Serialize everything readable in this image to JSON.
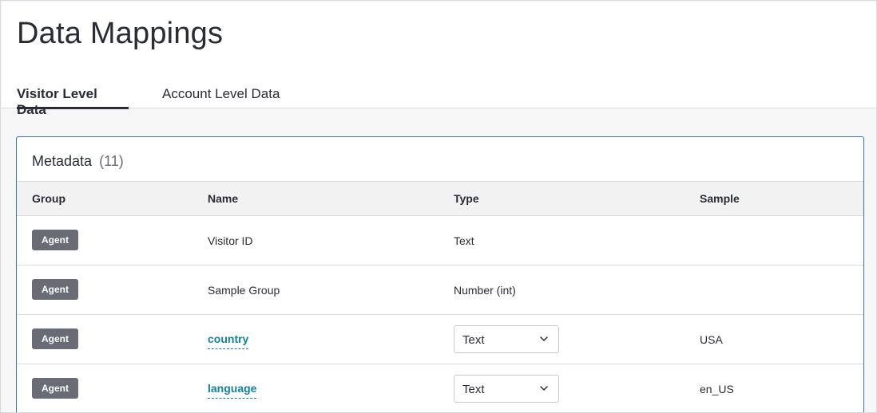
{
  "page": {
    "title": "Data Mappings"
  },
  "tabs": [
    {
      "label": "Visitor Level Data",
      "active": true
    },
    {
      "label": "Account Level Data",
      "active": false
    }
  ],
  "metadata": {
    "title": "Metadata",
    "count": "(11)",
    "columns": [
      "Group",
      "Name",
      "Type",
      "Sample"
    ],
    "rows": [
      {
        "group": "Agent",
        "name": "Visitor ID",
        "type": "Text",
        "sample": "",
        "editable": false
      },
      {
        "group": "Agent",
        "name": "Sample Group",
        "type": "Number (int)",
        "sample": "",
        "editable": false
      },
      {
        "group": "Agent",
        "name": "country",
        "type": "Text",
        "sample": "USA",
        "editable": true
      },
      {
        "group": "Agent",
        "name": "language",
        "type": "Text",
        "sample": "en_US",
        "editable": true
      }
    ]
  },
  "colors": {
    "link": "#128297",
    "badge": "#6a6c75",
    "card_border": "#3b6fb6"
  },
  "icons": {
    "select_chevron": "chevron-down-icon"
  }
}
